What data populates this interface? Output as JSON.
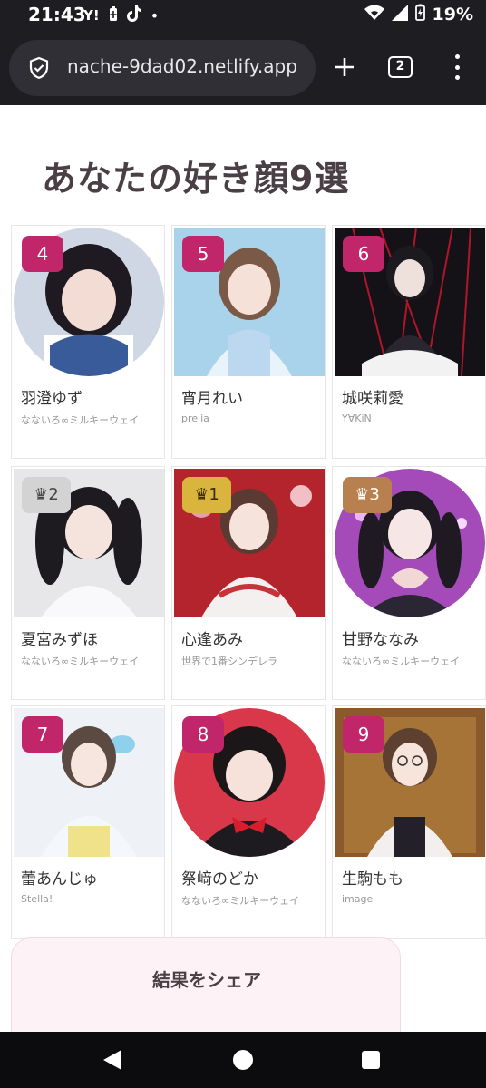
{
  "status_bar": {
    "time": "21:43",
    "left_icons": [
      "Y!",
      "battery-saver-icon",
      "tiktok-icon",
      "•"
    ],
    "battery": "19%"
  },
  "browser": {
    "url": "nache-9dad02.netlify.app",
    "tab_count": "2"
  },
  "page": {
    "title": "あなたの好き顔9選"
  },
  "cards": [
    {
      "rank": "4",
      "name": "羽澄ゆず",
      "group": "なないろ∞ミルキーウェイ",
      "badge_style": "plain"
    },
    {
      "rank": "5",
      "name": "宵月れい",
      "group": "prelia",
      "badge_style": "plain"
    },
    {
      "rank": "6",
      "name": "城咲莉愛",
      "group": "Y∀KiN",
      "badge_style": "plain"
    },
    {
      "rank": "♛2",
      "name": "夏宮みずほ",
      "group": "なないろ∞ミルキーウェイ",
      "badge_style": "silver"
    },
    {
      "rank": "♛1",
      "name": "心逢あみ",
      "group": "世界で1番シンデレラ",
      "badge_style": "gold"
    },
    {
      "rank": "♛3",
      "name": "甘野ななみ",
      "group": "なないろ∞ミルキーウェイ",
      "badge_style": "bronze"
    },
    {
      "rank": "7",
      "name": "蕾あんじゅ",
      "group": "Stella!",
      "badge_style": "plain"
    },
    {
      "rank": "8",
      "name": "祭﨑のどか",
      "group": "なないろ∞ミルキーウェイ",
      "badge_style": "plain"
    },
    {
      "rank": "9",
      "name": "生駒もも",
      "group": "image",
      "badge_style": "plain"
    }
  ],
  "share": {
    "title": "結果をシェア"
  },
  "colors": {
    "accent": "#c2266a",
    "silver": "#d3d3d3",
    "gold": "#dab53e",
    "bronze": "#b8804e"
  }
}
